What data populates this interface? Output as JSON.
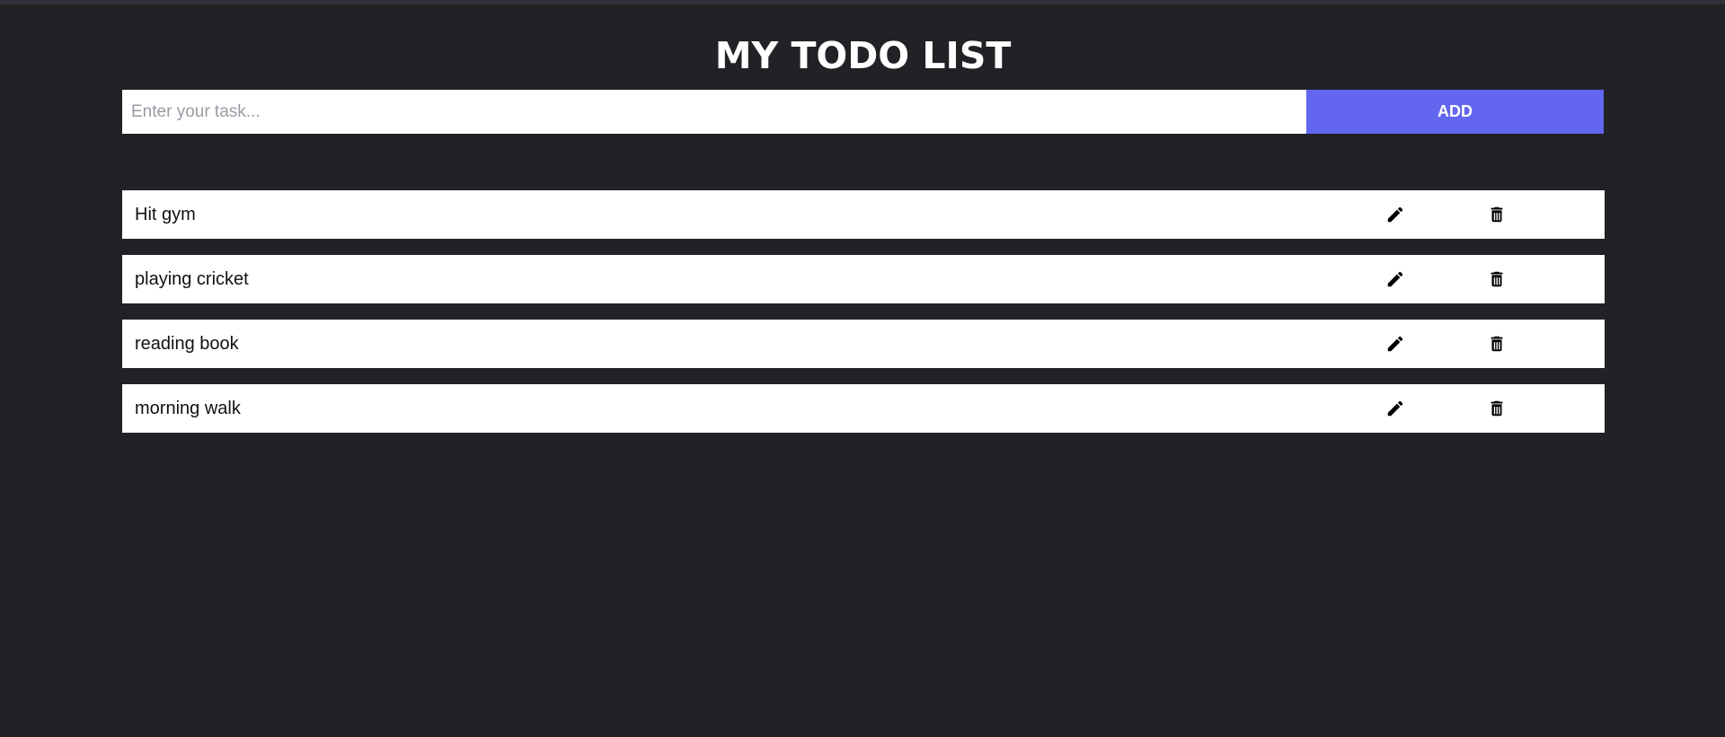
{
  "app": {
    "title": "MY TODO LIST"
  },
  "form": {
    "input_placeholder": "Enter your task...",
    "input_value": "",
    "add_label": "ADD"
  },
  "todos": [
    {
      "text": "Hit gym"
    },
    {
      "text": "playing cricket"
    },
    {
      "text": "reading book"
    },
    {
      "text": "morning walk"
    }
  ],
  "icons": {
    "edit": "pencil-icon",
    "delete": "trash-icon"
  },
  "colors": {
    "background": "#212226",
    "accent": "#6366ef",
    "item_background": "#ffffff"
  }
}
